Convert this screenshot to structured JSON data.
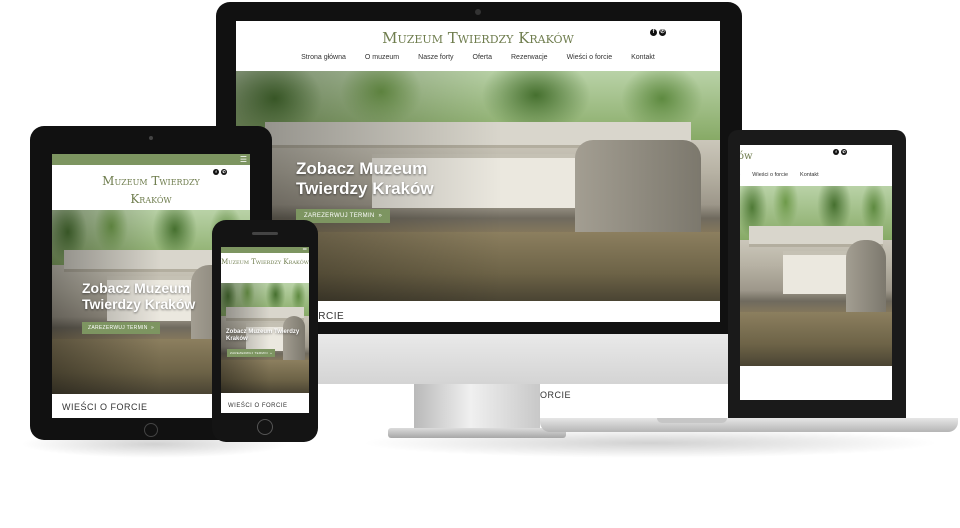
{
  "site": {
    "brand": "Muzeum Twierdzy Kraków",
    "brand_tablet_line1": "Muzeum Twierdzy",
    "brand_tablet_line2": "Kraków",
    "brand_phone": "Muzeum Twierdzy Kraków",
    "nav": [
      "Strona główna",
      "O muzeum",
      "Nasze forty",
      "Oferta",
      "Rezerwacje",
      "Wieści o forcie",
      "Kontakt"
    ],
    "laptop_nav_visible": [
      "ie",
      "Wieści o forcie",
      "Kontakt"
    ],
    "laptop_brand_fragment": "ów",
    "hero_title_line1": "Zobacz Muzeum",
    "hero_title_line2": "Twierdzy Kraków",
    "phone_hero_title_line1": "Zobacz Muzeum Twierdzy",
    "phone_hero_title_line2": "Kraków",
    "cta_label": "ZAREZERWUJ TERMIN",
    "cta_icon": "double-chevron-right-icon",
    "section_monitor": "ORCIE",
    "section_laptop": "ORCIE",
    "section_tablet": "WIEŚCI O FORCIE",
    "section_phone": "WIEŚCI O FORCIE",
    "social": {
      "facebook": "f",
      "whatsapp": "✆"
    },
    "menu_icon": "hamburger-icon"
  },
  "colors": {
    "accent_green": "#7d9561",
    "brand_text": "#6f7d4e",
    "header_bar": "#7d9561"
  }
}
